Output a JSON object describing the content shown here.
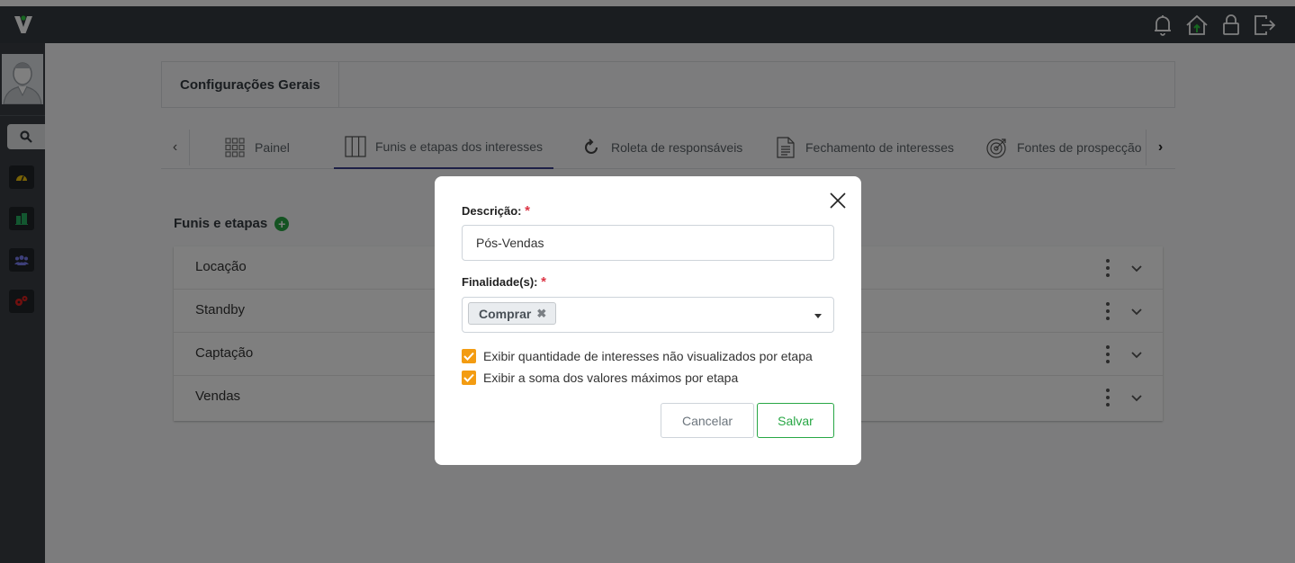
{
  "colors": {
    "topbar": "#343a40",
    "sidebar": "#3a3f44",
    "accent_green": "#28a745",
    "checkbox_orange": "#f39c12",
    "required_red": "#dc3545",
    "active_tab_underline": "#3b3f8c"
  },
  "topbar": {
    "logo": "V",
    "icons": [
      "bell-icon",
      "home-upload-icon",
      "lock-icon",
      "logout-icon"
    ]
  },
  "sidebar": {
    "items": [
      {
        "name": "search-icon"
      },
      {
        "name": "dashboard-gauge-icon"
      },
      {
        "name": "building-icon"
      },
      {
        "name": "users-icon"
      },
      {
        "name": "settings-gears-icon"
      }
    ]
  },
  "header": {
    "title": "Configurações Gerais"
  },
  "tabs": [
    {
      "label": "Painel",
      "icon": "grid-icon"
    },
    {
      "label": "Funis e etapas dos interesses",
      "icon": "columns-icon",
      "active": true
    },
    {
      "label": "Roleta de responsáveis",
      "icon": "refresh-icon"
    },
    {
      "label": "Fechamento de interesses",
      "icon": "document-icon"
    },
    {
      "label": "Fontes de prospecção",
      "icon": "target-icon"
    }
  ],
  "section": {
    "title": "Funis e etapas"
  },
  "funnels": [
    {
      "label": "Locação"
    },
    {
      "label": "Standby"
    },
    {
      "label": "Captação"
    },
    {
      "label": "Vendas"
    }
  ],
  "modal": {
    "description_label": "Descrição:",
    "required_mark": "*",
    "description_value": "Pós-Vendas",
    "purpose_label": "Finalidade(s):",
    "purpose_tag": "Comprar",
    "purpose_tag_remove": "✖",
    "check1_label": "Exibir quantidade de interesses não visualizados por etapa",
    "check1_checked": true,
    "check2_label": "Exibir a soma dos valores máximos por etapa",
    "check2_checked": true,
    "cancel_label": "Cancelar",
    "save_label": "Salvar"
  }
}
